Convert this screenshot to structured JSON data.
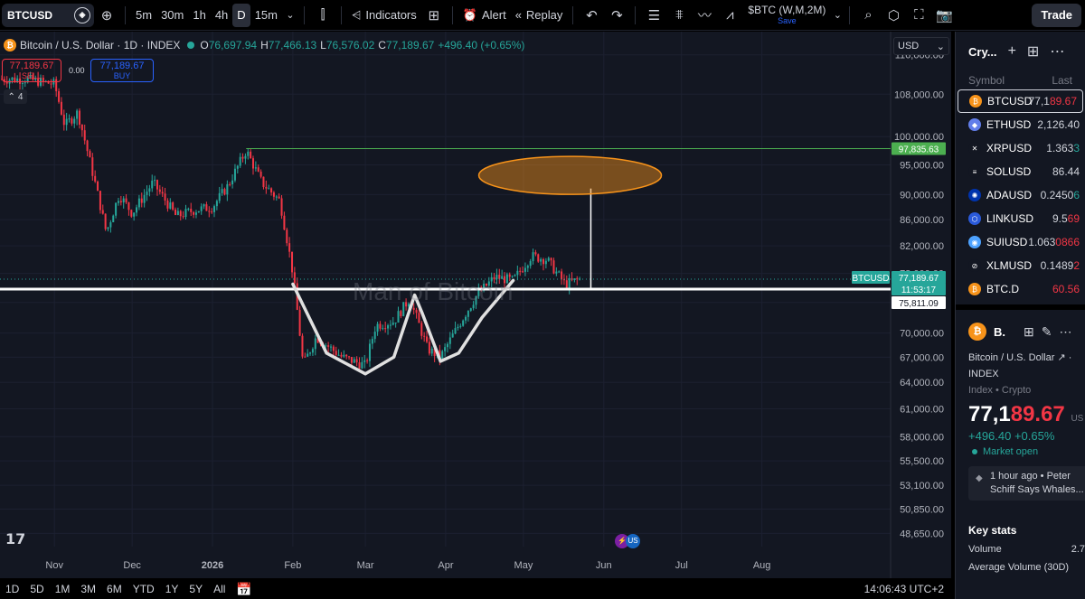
{
  "toolbar": {
    "symbol": "BTCUSD",
    "intervals": [
      "5m",
      "30m",
      "1h",
      "4h",
      "D",
      "15m"
    ],
    "active_interval": "D",
    "indicators_label": "Indicators",
    "alert_label": "Alert",
    "replay_label": "Replay",
    "compare_title": "$BTC (W,M,2M)",
    "compare_sub": "Save",
    "trade_label": "Trade"
  },
  "legend": {
    "title": "Bitcoin / U.S. Dollar · 1D · INDEX",
    "o_label": "O",
    "o_value": "76,697.94",
    "h_label": "H",
    "h_value": "77,466.13",
    "l_label": "L",
    "l_value": "76,576.02",
    "c_label": "C",
    "c_value": "77,189.67",
    "change": "+496.40 (+0.65%)"
  },
  "order": {
    "sell_price": "77,189.67",
    "sell_label": "SELL",
    "spread": "0.00",
    "buy_price": "77,189.67",
    "buy_label": "BUY",
    "collapse_count": "4"
  },
  "watermark": "Man of Bitcoin",
  "currency": "USD",
  "price_axis": [
    "116,000.00",
    "108,000.00",
    "100,000.00",
    "95,000.00",
    "90,000.00",
    "86,000.00",
    "82,000.00",
    "78,000.00",
    "74,000.00",
    "70,000.00",
    "67,000.00",
    "64,000.00",
    "61,000.00",
    "58,000.00",
    "55,500.00",
    "53,100.00",
    "50,850.00",
    "48,650.00"
  ],
  "price_tags": {
    "resistance": "97,835.63",
    "symbol_tag": "BTCUSD",
    "current": "77,189.67",
    "countdown": "11:53:17",
    "support": "75,811.09"
  },
  "time_axis": [
    "Nov",
    "Dec",
    "2026",
    "Feb",
    "Mar",
    "Apr",
    "May",
    "Jun",
    "Jul",
    "Aug"
  ],
  "ranges": [
    "1D",
    "5D",
    "1M",
    "3M",
    "6M",
    "YTD",
    "1Y",
    "5Y",
    "All"
  ],
  "clock": "14:06:43 UTC+2",
  "colors": {
    "up": "#26a69a",
    "down": "#f23645",
    "accent": "#2962ff",
    "resistance": "#4caf50",
    "target": "#f7931a"
  },
  "chart_data": {
    "type": "candlestick",
    "title": "Bitcoin / U.S. Dollar · 1D · INDEX",
    "y_scale": "log",
    "ylim": [
      47500,
      121000
    ],
    "resistance_level": 97835.63,
    "support_level": 75811.09,
    "current_price": 77189.67,
    "trend_points": [
      {
        "x": "2025-10-21",
        "y": 111000
      },
      {
        "x": "2025-11-01",
        "y": 110000
      },
      {
        "x": "2025-11-05",
        "y": 102000
      },
      {
        "x": "2025-11-10",
        "y": 104500
      },
      {
        "x": "2025-11-15",
        "y": 95000
      },
      {
        "x": "2025-11-21",
        "y": 84000
      },
      {
        "x": "2025-11-26",
        "y": 90000
      },
      {
        "x": "2025-12-01",
        "y": 87000
      },
      {
        "x": "2025-12-09",
        "y": 92000
      },
      {
        "x": "2025-12-18",
        "y": 86500
      },
      {
        "x": "2025-12-25",
        "y": 87500
      },
      {
        "x": "2026-01-01",
        "y": 88000
      },
      {
        "x": "2026-01-07",
        "y": 91500
      },
      {
        "x": "2026-01-14",
        "y": 97500
      },
      {
        "x": "2026-01-20",
        "y": 92000
      },
      {
        "x": "2026-01-27",
        "y": 89000
      },
      {
        "x": "2026-02-01",
        "y": 78000
      },
      {
        "x": "2026-02-05",
        "y": 66000
      },
      {
        "x": "2026-02-10",
        "y": 69500
      },
      {
        "x": "2026-02-20",
        "y": 67000
      },
      {
        "x": "2026-03-01",
        "y": 66000
      },
      {
        "x": "2026-03-05",
        "y": 71000
      },
      {
        "x": "2026-03-12",
        "y": 71500
      },
      {
        "x": "2026-03-18",
        "y": 74500
      },
      {
        "x": "2026-03-25",
        "y": 68000
      },
      {
        "x": "2026-03-30",
        "y": 67000
      },
      {
        "x": "2026-04-06",
        "y": 71000
      },
      {
        "x": "2026-04-13",
        "y": 75000
      },
      {
        "x": "2026-04-20",
        "y": 77500
      },
      {
        "x": "2026-04-27",
        "y": 77000
      },
      {
        "x": "2026-05-04",
        "y": 80500
      },
      {
        "x": "2026-05-10",
        "y": 80000
      },
      {
        "x": "2026-05-17",
        "y": 76500
      },
      {
        "x": "2026-05-23",
        "y": 77189.67
      }
    ]
  },
  "watchlist": {
    "title": "Cry...",
    "col_symbol": "Symbol",
    "col_last": "Last",
    "rows": [
      {
        "symbol": "BTCUSD",
        "last_a": "77,1",
        "last_b": "89.67",
        "hl": "r",
        "icon": "₿",
        "color": "#f7931a"
      },
      {
        "symbol": "ETHUSD",
        "last_a": "2,126.40",
        "last_b": "",
        "hl": "",
        "icon": "◆",
        "color": "#627eea"
      },
      {
        "symbol": "XRPUSD",
        "last_a": "1.363",
        "last_b": "3",
        "hl": "g",
        "icon": "✕",
        "color": "#131722"
      },
      {
        "symbol": "SOLUSD",
        "last_a": "86.44",
        "last_b": "",
        "hl": "",
        "icon": "≡",
        "color": "#131722"
      },
      {
        "symbol": "ADAUSD",
        "last_a": "0.2450",
        "last_b": "6",
        "hl": "g",
        "icon": "✺",
        "color": "#0033ad"
      },
      {
        "symbol": "LINKUSD",
        "last_a": "9.5",
        "last_b": "69",
        "hl": "r",
        "icon": "⬡",
        "color": "#2a5ada"
      },
      {
        "symbol": "SUIUSD",
        "last_a": "1.063",
        "last_b": "0866",
        "hl": "r",
        "icon": "◉",
        "color": "#4da2ff"
      },
      {
        "symbol": "XLMUSD",
        "last_a": "0.1489",
        "last_b": "2",
        "hl": "r",
        "icon": "⊘",
        "color": "#131722"
      },
      {
        "symbol": "BTC.D",
        "last_a": "60.56",
        "last_b": "",
        "hl": "",
        "icon": "₿",
        "color": "#f7931a",
        "red": true
      }
    ]
  },
  "details": {
    "short": "B.",
    "name": "Bitcoin / U.S. Dollar",
    "exchange": "INDEX",
    "category": "Index • Crypto",
    "price_a": "77,1",
    "price_b": "89.67",
    "currency": "US",
    "change": "+496.40  +0.65%",
    "status": "Market open",
    "news_time": "1 hour ago • Peter",
    "news_text": "Schiff Says Whales...",
    "key_stats": "Key stats",
    "volume_label": "Volume",
    "volume_value": "2.7",
    "avg_volume_label": "Average Volume (30D)"
  }
}
